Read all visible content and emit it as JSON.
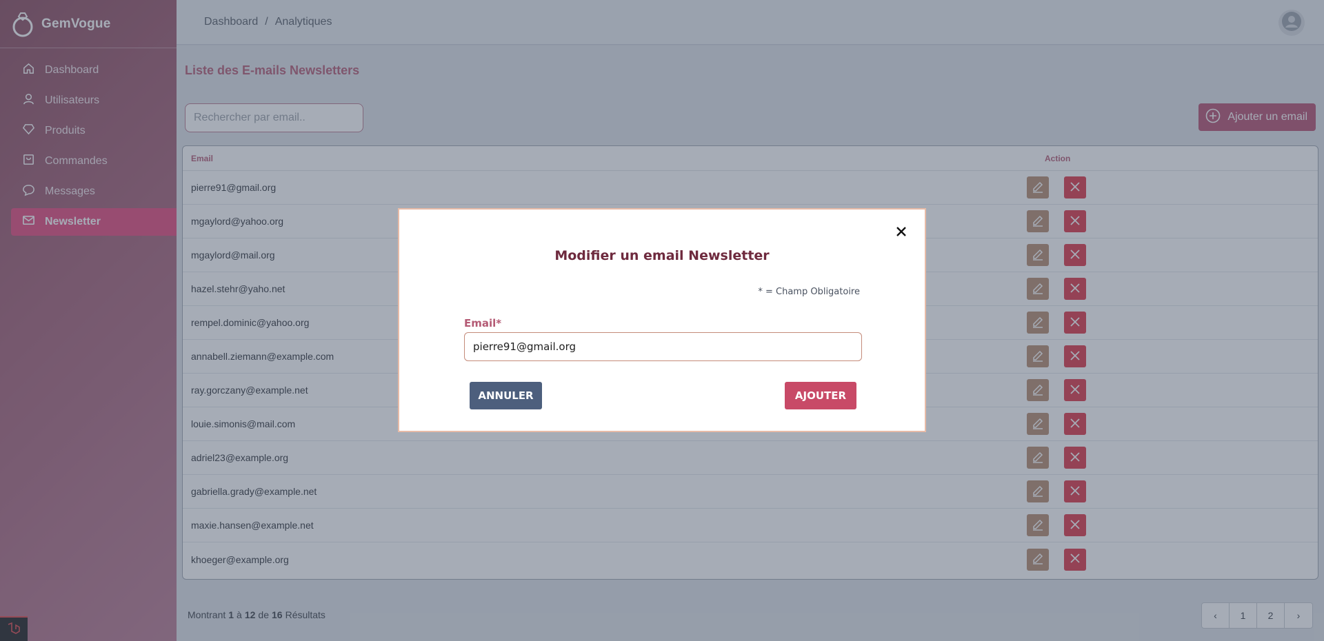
{
  "brand": {
    "name": "GemVogue"
  },
  "sidebar": {
    "items": [
      {
        "label": "Dashboard",
        "icon": "home-icon"
      },
      {
        "label": "Utilisateurs",
        "icon": "user-icon"
      },
      {
        "label": "Produits",
        "icon": "diamond-icon"
      },
      {
        "label": "Commandes",
        "icon": "bag-icon"
      },
      {
        "label": "Messages",
        "icon": "chat-bubble-icon"
      },
      {
        "label": "Newsletter",
        "icon": "mail-icon",
        "active": true
      }
    ]
  },
  "breadcrumb": {
    "root": "Dashboard",
    "separator": "/",
    "current": "Analytiques"
  },
  "main": {
    "title": "Liste des E-mails Newsletters",
    "search_placeholder": "Rechercher par email..",
    "add_button_label": "Ajouter un email"
  },
  "table": {
    "headers": {
      "email": "Email",
      "action": "Action"
    },
    "rows": [
      "pierre91@gmail.org",
      "mgaylord@yahoo.org",
      "mgaylord@mail.org",
      "hazel.stehr@yaho.net",
      "rempel.dominic@yahoo.org",
      "annabell.ziemann@example.com",
      "ray.gorczany@example.net",
      "louie.simonis@mail.com",
      "adriel23@example.org",
      "gabriella.grady@example.net",
      "maxie.hansen@example.net",
      "khoeger@example.org"
    ]
  },
  "pagination": {
    "prefix": "Montrant",
    "from": "1",
    "to_word": "à",
    "to": "12",
    "of_word": "de",
    "total": "16",
    "suffix": "Résultats",
    "pages": [
      "1",
      "2"
    ],
    "prev": "‹",
    "next": "›"
  },
  "modal": {
    "title": "Modifier un email Newsletter",
    "required_note": "* = Champ Obligatoire",
    "field_label": "Email*",
    "field_value": "pierre91@gmail.org",
    "cancel_label": "ANNULER",
    "submit_label": "AJOUTER"
  },
  "colors": {
    "accent": "#e5487c",
    "edit": "#b48a6d",
    "delete": "#dc3545",
    "cancel": "#4d5f7d",
    "submit": "#c84a67"
  }
}
